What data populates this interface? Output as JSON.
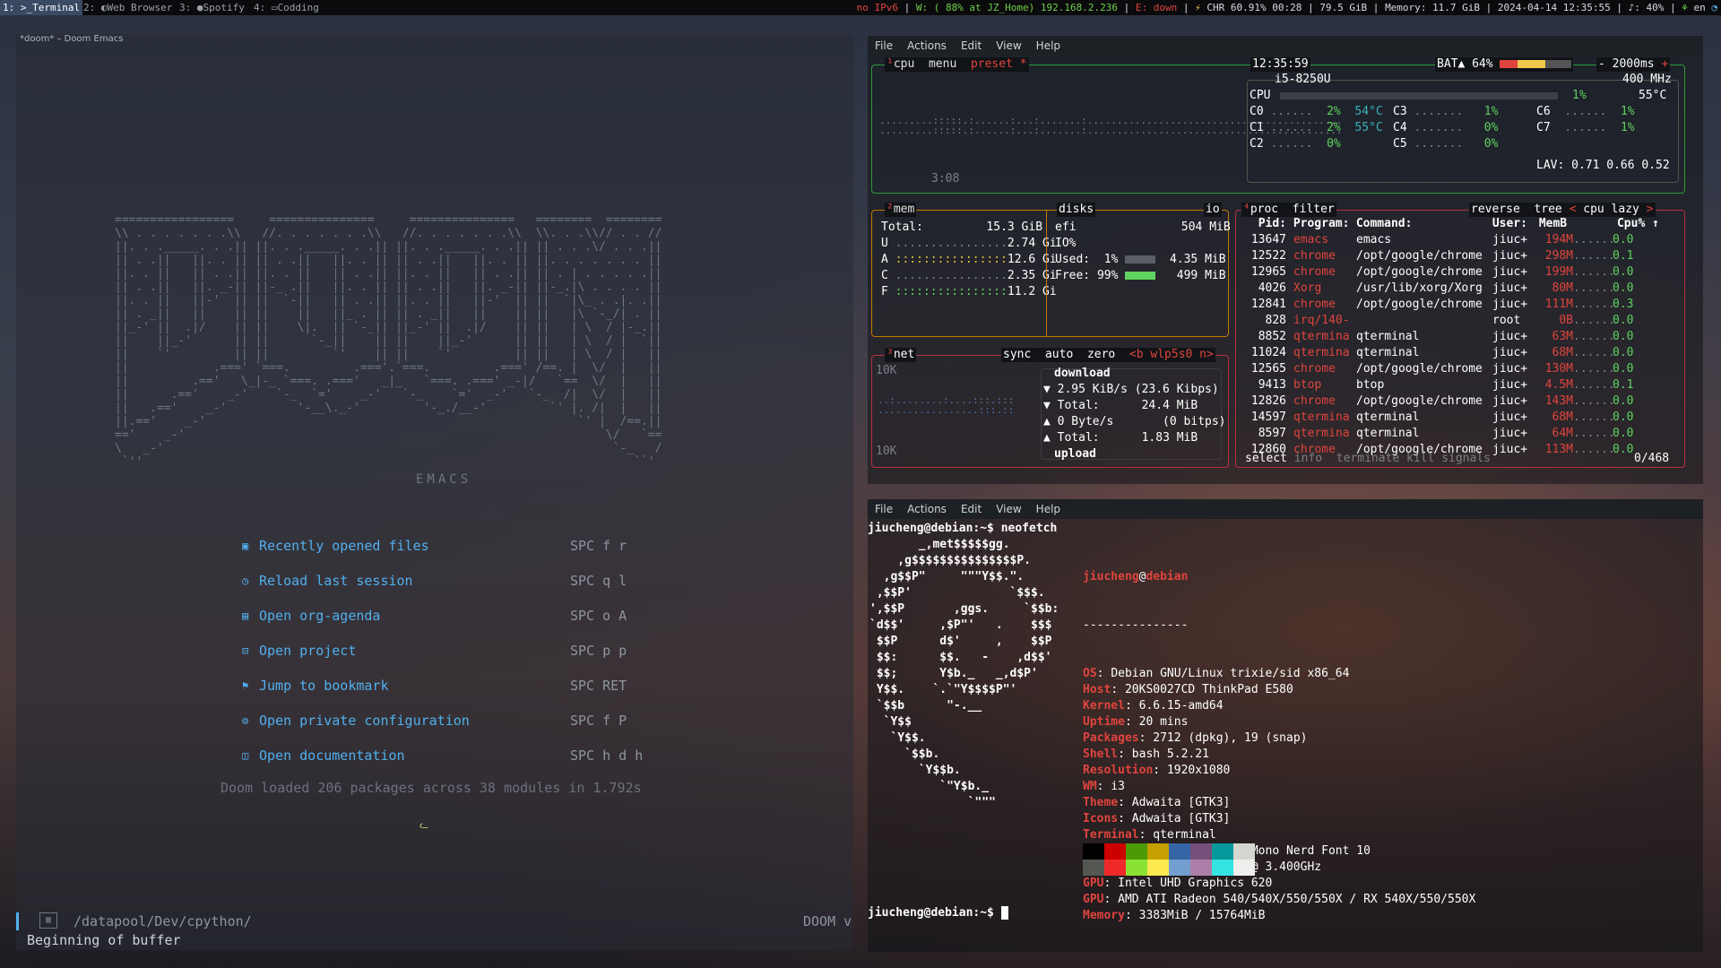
{
  "topbar": {
    "workspaces": [
      {
        "num": "1:",
        "label": ">_Terminal",
        "active": true
      },
      {
        "num": "2:",
        "label": "Web Browser",
        "icon": "globe-icon"
      },
      {
        "num": "3:",
        "label": "Spotify",
        "icon": "spotify-icon"
      },
      {
        "num": "4:",
        "label": "Codding",
        "icon": "code-icon"
      }
    ],
    "status": {
      "ipv6": "no IPv6",
      "wifi": "W: ( 88% at JZ_Home) 192.168.2.236",
      "ethernet": "E: down",
      "battery": "CHR 60.91% 00:28",
      "disk": "79.5 GiB",
      "memory": "Memory: 11.7 GiB",
      "datetime": "2024-04-14 12:35:55",
      "volume": "40%",
      "lang": "en"
    }
  },
  "emacs": {
    "title": "*doom* – Doom Emacs",
    "banner_sub": "EMACS",
    "menu": [
      {
        "icon": "file-icon",
        "label": "Recently opened files",
        "key": "SPC f r"
      },
      {
        "icon": "history-icon",
        "label": "Reload last session",
        "key": "SPC q l"
      },
      {
        "icon": "calendar-icon",
        "label": "Open org-agenda",
        "key": "SPC o A"
      },
      {
        "icon": "briefcase-icon",
        "label": "Open project",
        "key": "SPC p p"
      },
      {
        "icon": "bookmark-icon",
        "label": "Jump to bookmark",
        "key": "SPC RET"
      },
      {
        "icon": "tools-icon",
        "label": "Open private configuration",
        "key": "SPC f P"
      },
      {
        "icon": "book-icon",
        "label": "Open documentation",
        "key": "SPC h d h"
      }
    ],
    "loaded": "Doom loaded 206 packages across 38 modules in 1.792s",
    "modeline": {
      "path": "/datapool/Dev/cpython/",
      "mode": "DOOM v"
    },
    "echo": "Beginning of buffer"
  },
  "term_menu": [
    "File",
    "Actions",
    "Edit",
    "View",
    "Help"
  ],
  "btop": {
    "cpu_tabs": {
      "cpu": "cpu",
      "menu": "menu",
      "preset": "preset *"
    },
    "clock": "12:35:59",
    "battery": "BAT▲ 64%",
    "battery_pct": 64,
    "interval": "2000ms",
    "cpu_model": "i5-8250U",
    "freq": "400 MHz",
    "cpu_total": "1%",
    "cpu_temp": "55°C",
    "uptime": "3:08",
    "cores": [
      {
        "name": "C0",
        "pct": "2%",
        "temp": "54°C"
      },
      {
        "name": "C1",
        "pct": "2%",
        "temp": "55°C"
      },
      {
        "name": "C2",
        "pct": "0%",
        "temp": ""
      },
      {
        "name": "C3",
        "pct": "1%"
      },
      {
        "name": "C4",
        "pct": "0%"
      },
      {
        "name": "C5",
        "pct": "0%"
      },
      {
        "name": "C6",
        "pct": "1%"
      },
      {
        "name": "C7",
        "pct": "1%"
      }
    ],
    "lav": "LAV: 0.71 0.66 0.52",
    "mem": {
      "title": "mem",
      "total_label": "Total:",
      "total": "15.3 GiB",
      "rows": [
        {
          "k": "U",
          "v": "2.74 Gi"
        },
        {
          "k": "A",
          "v": "12.6 Gi"
        },
        {
          "k": "C",
          "v": "2.35 Gi"
        },
        {
          "k": "F",
          "v": "11.2 Gi"
        }
      ]
    },
    "disks": {
      "title": "disks",
      "io": "io",
      "name": "efi",
      "size": "504 MiB",
      "io_pct": "IO%",
      "used_label": "Used:",
      "used_pct": "1%",
      "used": "4.35 MiB",
      "free_label": "Free:",
      "free_pct": "99%",
      "free": "499 MiB"
    },
    "net": {
      "title": "net",
      "sync": "sync",
      "auto": "auto",
      "zero": "zero",
      "iface": "<b wlp5s0 n>",
      "scale_top": "10K",
      "scale_bottom": "10K",
      "download": "download",
      "down_rate": "2.95 KiB/s (23.6 Kibps)",
      "down_total": "24.4 MiB",
      "up_rate": "0 Byte/s       (0 bitps)",
      "up_total": "1.83 MiB",
      "upload": "upload",
      "total_label": "Total:"
    },
    "proc": {
      "title": "proc",
      "filter": "filter",
      "reverse": "reverse",
      "tree": "tree",
      "sort": "< cpu lazy >",
      "headers": [
        "Pid:",
        "Program:",
        "Command:",
        "User:",
        "MemB",
        "Cpu%"
      ],
      "rows": [
        [
          "13647",
          "emacs",
          "emacs",
          "jiuc+",
          "194M",
          "0.0"
        ],
        [
          "12522",
          "chrome",
          "/opt/google/chrome",
          "jiuc+",
          "298M",
          "0.1"
        ],
        [
          "12965",
          "chrome",
          "/opt/google/chrome",
          "jiuc+",
          "199M",
          "0.0"
        ],
        [
          "4026",
          "Xorg",
          "/usr/lib/xorg/Xorg",
          "jiuc+",
          "80M",
          "0.0"
        ],
        [
          "12841",
          "chrome",
          "/opt/google/chrome",
          "jiuc+",
          "111M",
          "0.3"
        ],
        [
          "828",
          "irq/140-",
          "",
          "root",
          "0B",
          "0.0"
        ],
        [
          "8852",
          "qtermina",
          "qterminal",
          "jiuc+",
          "63M",
          "0.0"
        ],
        [
          "11024",
          "qtermina",
          "qterminal",
          "jiuc+",
          "68M",
          "0.0"
        ],
        [
          "12565",
          "chrome",
          "/opt/google/chrome",
          "jiuc+",
          "130M",
          "0.0"
        ],
        [
          "9413",
          "btop",
          "btop",
          "jiuc+",
          "4.5M",
          "0.1"
        ],
        [
          "12826",
          "chrome",
          "/opt/google/chrome",
          "jiuc+",
          "143M",
          "0.0"
        ],
        [
          "14597",
          "qtermina",
          "qterminal",
          "jiuc+",
          "68M",
          "0.0"
        ],
        [
          "8597",
          "qtermina",
          "qterminal",
          "jiuc+",
          "64M",
          "0.0"
        ],
        [
          "12860",
          "chrome",
          "/opt/google/chrome",
          "jiuc+",
          "113M",
          "0.0"
        ]
      ],
      "footer": {
        "select": "select",
        "info": "info",
        "terminate": "terminate",
        "kill": "kill",
        "signals": "signals",
        "count": "0/468"
      }
    }
  },
  "neofetch": {
    "prompt": "jiucheng@debian:~$ neofetch",
    "user": "jiucheng",
    "at": "@",
    "host": "debian",
    "sep": "---------------",
    "info": [
      {
        "k": "OS",
        "v": "Debian GNU/Linux trixie/sid x86_64"
      },
      {
        "k": "Host",
        "v": "20KS0027CD ThinkPad E580"
      },
      {
        "k": "Kernel",
        "v": "6.6.15-amd64"
      },
      {
        "k": "Uptime",
        "v": "20 mins"
      },
      {
        "k": "Packages",
        "v": "2712 (dpkg), 19 (snap)"
      },
      {
        "k": "Shell",
        "v": "bash 5.2.21"
      },
      {
        "k": "Resolution",
        "v": "1920x1080"
      },
      {
        "k": "WM",
        "v": "i3"
      },
      {
        "k": "Theme",
        "v": "Adwaita [GTK3]"
      },
      {
        "k": "Icons",
        "v": "Adwaita [GTK3]"
      },
      {
        "k": "Terminal",
        "v": "qterminal"
      },
      {
        "k": "Terminal Font",
        "v": "JetBrainsMono Nerd Font 10"
      },
      {
        "k": "CPU",
        "v": "Intel i5-8250U (8) @ 3.400GHz"
      },
      {
        "k": "GPU",
        "v": "Intel UHD Graphics 620"
      },
      {
        "k": "GPU",
        "v": "AMD ATI Radeon 540/540X/550/550X / RX 540X/550/550X"
      },
      {
        "k": "Memory",
        "v": "3383MiB / 15764MiB"
      }
    ],
    "colors_top": [
      "#000000",
      "#cc0000",
      "#4e9a06",
      "#c4a000",
      "#3465a4",
      "#75507b",
      "#06989a",
      "#d3d7cf"
    ],
    "colors_bottom": [
      "#555753",
      "#ef2929",
      "#8ae234",
      "#fce94f",
      "#729fcf",
      "#ad7fa8",
      "#34e2e2",
      "#eeeeec"
    ],
    "final_prompt": "jiucheng@debian:~$"
  }
}
